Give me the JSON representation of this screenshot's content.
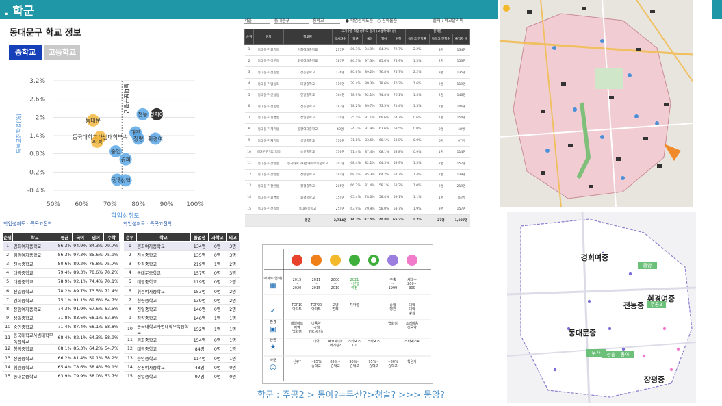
{
  "header": {
    "title": ". 학군"
  },
  "left": {
    "title": "동대문구 학교 정보",
    "tabs": [
      {
        "label": "중학교",
        "active": true
      },
      {
        "label": "고등학교",
        "active": false
      }
    ],
    "notes": [
      "학업성취도 : 특목고진학",
      "학업성취도 : 특목고진학"
    ]
  },
  "chart_data": {
    "type": "scatter",
    "xlabel": "학업성취도",
    "ylabel": "특목고진학률(%)",
    "xticks": [
      "50%",
      "60%",
      "70%",
      "80%",
      "90%",
      "100%"
    ],
    "yticks": [
      "3.2%",
      "2.6%",
      "2%",
      "1.4%",
      "0.8%",
      "0.2%",
      "-0.4%"
    ],
    "xlim": [
      0.5,
      1.0
    ],
    "ylim": [
      -0.4,
      3.2
    ],
    "points": [
      {
        "name": "동대문",
        "x": 0.64,
        "y": 1.9,
        "color": "#f3b93e"
      },
      {
        "name": "동국대학교사범대학부속",
        "x": 0.665,
        "y": 1.35,
        "color": "#f3b93e"
      },
      {
        "name": "휘경",
        "x": 0.655,
        "y": 1.2,
        "color": "#f3b93e"
      },
      {
        "name": "숭인",
        "x": 0.72,
        "y": 0.88,
        "color": "#5ba8e8"
      },
      {
        "name": "경희",
        "x": 0.755,
        "y": 0.62,
        "color": "#5ba8e8"
      },
      {
        "name": "장평",
        "x": 0.725,
        "y": -0.05,
        "color": "#5ba8e8"
      },
      {
        "name": "성일",
        "x": 0.755,
        "y": -0.07,
        "color": "#5ba8e8"
      },
      {
        "name": "전농",
        "x": 0.815,
        "y": 2.1,
        "color": "#5ba8e8"
      },
      {
        "name": "경희여",
        "x": 0.865,
        "y": 2.1,
        "color": "#111111"
      },
      {
        "name": "대광",
        "x": 0.79,
        "y": 1.5,
        "color": "#5ba8e8"
      },
      {
        "name": "청량",
        "x": 0.8,
        "y": 1.3,
        "color": "#5ba8e8"
      },
      {
        "name": "휘경여",
        "x": 0.86,
        "y": 1.3,
        "color": "#5ba8e8"
      }
    ],
    "avg_label": "동대문구평균"
  },
  "table_a": {
    "headers": [
      "순위",
      "학교",
      "평균",
      "국어",
      "영어",
      "수학"
    ],
    "rows": [
      [
        "1",
        "경희여자중학교",
        "86.3%",
        "94.9%",
        "84.3%",
        "79.7%"
      ],
      [
        "2",
        "휘경여자중학교",
        "86.3%",
        "97.3%",
        "85.6%",
        "75.9%"
      ],
      [
        "3",
        "전농중학교",
        "80.6%",
        "89.2%",
        "76.8%",
        "75.7%"
      ],
      [
        "4",
        "대광중학교",
        "79.4%",
        "89.3%",
        "78.6%",
        "70.2%"
      ],
      [
        "5",
        "대광중학교",
        "78.9%",
        "92.1%",
        "74.4%",
        "70.1%"
      ],
      [
        "6",
        "전일중학교",
        "78.2%",
        "89.7%",
        "73.5%",
        "71.4%"
      ],
      [
        "7",
        "경희중학교",
        "75.1%",
        "91.1%",
        "69.6%",
        "64.7%"
      ],
      [
        "8",
        "장평여자중학교",
        "74.3%",
        "91.9%",
        "67.6%",
        "63.5%"
      ],
      [
        "9",
        "성일중학교",
        "71.8%",
        "83.6%",
        "68.1%",
        "63.8%"
      ],
      [
        "10",
        "숭인중학교",
        "71.4%",
        "87.4%",
        "68.1%",
        "58.8%"
      ],
      [
        "11",
        "동국대학교사범대학부속중학교",
        "68.4%",
        "82.1%",
        "64.3%",
        "58.9%"
      ],
      [
        "12",
        "청량중학교",
        "68.1%",
        "85.3%",
        "64.2%",
        "54.7%"
      ],
      [
        "13",
        "장평중학교",
        "66.2%",
        "81.4%",
        "59.1%",
        "58.2%"
      ],
      [
        "14",
        "휘경중학교",
        "65.4%",
        "78.6%",
        "58.4%",
        "59.1%"
      ],
      [
        "15",
        "동대문중학교",
        "63.9%",
        "79.9%",
        "58.0%",
        "53.7%"
      ]
    ]
  },
  "table_b": {
    "headers": [
      "순위",
      "학교",
      "졸업생",
      "과학고",
      "외고"
    ],
    "rows": [
      [
        "1",
        "경희여자중학교",
        "134명",
        "0명",
        "3명"
      ],
      [
        "2",
        "전농중학교",
        "135명",
        "0명",
        "3명"
      ],
      [
        "3",
        "장평중학교",
        "219명",
        "1명",
        "2명"
      ],
      [
        "4",
        "동대문중학교",
        "157명",
        "0명",
        "3명"
      ],
      [
        "5",
        "대광중학교",
        "119명",
        "0명",
        "2명"
      ],
      [
        "6",
        "휘경여자중학교",
        "153명",
        "0명",
        "2명"
      ],
      [
        "7",
        "청량중학교",
        "139명",
        "0명",
        "2명"
      ],
      [
        "8",
        "전일중학교",
        "146명",
        "0명",
        "2명"
      ],
      [
        "9",
        "청량중학교",
        "146명",
        "1명",
        "1명"
      ],
      [
        "10",
        "동국대학교사범대학부속중학교",
        "152명",
        "1명",
        "1명"
      ],
      [
        "11",
        "경희중학교",
        "154명",
        "0명",
        "1명"
      ],
      [
        "12",
        "대광중학교",
        "84명",
        "0명",
        "1명"
      ],
      [
        "13",
        "숭인중학교",
        "114명",
        "0명",
        "1명"
      ],
      [
        "14",
        "장평여자중학교",
        "48명",
        "0명",
        "0명"
      ],
      [
        "15",
        "성일중학교",
        "97명",
        "0명",
        "0명"
      ]
    ]
  },
  "mid": {
    "filters": [
      "서울",
      "동대문구",
      "중학교"
    ],
    "radio": [
      "학업성취도순",
      "진학률순"
    ],
    "source": "출처 : 학교알리미",
    "headers": [
      "순위",
      "위치",
      "학교명",
      "응시자수",
      "평균",
      "국어",
      "영어",
      "수학",
      "특목고 진학률",
      "특목고 진학수",
      "졸업자 수"
    ],
    "group_header": "국가수준 학업성취도 평가 (보통학력이상)",
    "group_header2": "진학률",
    "rows": [
      [
        "1",
        "동대문구 휘경동",
        "경희여자중학교",
        "217명",
        "86.3%",
        "94.9%",
        "84.3%",
        "79.7%",
        "2.2%",
        "3명",
        "134명"
      ],
      [
        "2",
        "동대문구 이문동",
        "휘경여자중학교",
        "187명",
        "86.3%",
        "97.3%",
        "85.6%",
        "75.9%",
        "1.3%",
        "2명",
        "153명"
      ],
      [
        "3",
        "동대문구 전농동",
        "전농중학교",
        "176명",
        "80.6%",
        "89.2%",
        "76.8%",
        "75.7%",
        "2.2%",
        "3명",
        "135명"
      ],
      [
        "4",
        "동대문구 답십리",
        "대광중학교",
        "119명",
        "79.4%",
        "89.3%",
        "78.6%",
        "70.2%",
        "1.6%",
        "2명",
        "119명"
      ],
      [
        "5",
        "동대문구 신설동",
        "전일중학교",
        "164명",
        "78.9%",
        "92.1%",
        "74.4%",
        "70.1%",
        "1.3%",
        "2명",
        "146명"
      ],
      [
        "6",
        "동대문구 전농동",
        "전농중학교",
        "183명",
        "78.2%",
        "89.7%",
        "73.5%",
        "71.4%",
        "1.3%",
        "2명",
        "146명"
      ],
      [
        "7",
        "동대문구 휘경동",
        "성일중학교",
        "214명",
        "75.1%",
        "91.1%",
        "69.6%",
        "64.7%",
        "0.6%",
        "1명",
        "154명"
      ],
      [
        "8",
        "동대문구 제기동",
        "장평여자중학교",
        "48명",
        "74.3%",
        "91.9%",
        "67.6%",
        "63.5%",
        "0.0%",
        "0명",
        "48명"
      ],
      [
        "9",
        "동대문구 제기동",
        "성일중학교",
        "110명",
        "71.8%",
        "83.6%",
        "68.1%",
        "63.8%",
        "0.0%",
        "0명",
        "97명"
      ],
      [
        "10",
        "동대문구 답십리동",
        "숭인중학교",
        "116명",
        "71.4%",
        "87.4%",
        "68.1%",
        "58.8%",
        "0.9%",
        "1명",
        "114명"
      ],
      [
        "11",
        "동대문구 장안동",
        "동국대학교사범대학부속중학교",
        "207명",
        "68.4%",
        "82.1%",
        "64.3%",
        "58.9%",
        "1.3%",
        "2명",
        "152명"
      ],
      [
        "12",
        "동대문구 장안동",
        "청량중학교",
        "191명",
        "68.1%",
        "85.3%",
        "64.2%",
        "54.7%",
        "1.4%",
        "2명",
        "139명"
      ],
      [
        "13",
        "동대문구 장안동",
        "장평중학교",
        "205명",
        "66.2%",
        "81.4%",
        "59.1%",
        "58.2%",
        "1.0%",
        "2명",
        "219명"
      ],
      [
        "14",
        "동대문구 휘경동",
        "휘경중학교",
        "154명",
        "65.4%",
        "78.6%",
        "58.4%",
        "59.1%",
        "1.1%",
        "1명",
        "84명"
      ],
      [
        "15",
        "동대문구 전농동",
        "동대문중학교",
        "254명",
        "63.9%",
        "79.9%",
        "58.0%",
        "53.7%",
        "1.9%",
        "3명",
        "157명"
      ]
    ],
    "total": [
      "",
      "",
      "평균",
      "2,714명",
      "74.2%",
      "87.5%",
      "70.0%",
      "65.2%",
      "1.2%",
      "27명",
      "1,997명"
    ]
  },
  "legend_grid": {
    "colors": [
      "#e8412c",
      "#f07f18",
      "#f3b92b",
      "#3fae3a",
      "#3fae3a",
      "#9b7ee0",
      "#f17ccb"
    ],
    "row_labels": [
      "아파트(연식)",
      "",
      "환경",
      "상권",
      "학군"
    ],
    "row1": [
      "2015\n~\n2020",
      "2011\n~\n2015",
      "2000\n~\n2010",
      "2021\n~진행\n예정",
      "",
      "구축\n~\n1999",
      "세대수\n200~\n300"
    ],
    "row2": [
      "TOP10\n아파트",
      "TOP20\n아파트",
      "모양\n범례",
      "지하철",
      "",
      "종합\n병원",
      "대학\n대학\n병원"
    ],
    "row3": [
      "대형마트\n지역\n백화점",
      "이용약\n~(월\nNC,세이)",
      "",
      "",
      "",
      "백화점",
      "조리비용\n이용약"
    ],
    "row4": [
      "",
      "대학",
      "쎄브웨이?\n머거킹?",
      "스타벅스\nDT",
      "스타벅스",
      "",
      "스타벅스R"
    ],
    "row5": [
      "신규?",
      "~85%\n중학교",
      "85%~\n중학교",
      "90%~\n중학교",
      "95%~\n중학교",
      "~80%\n중학교",
      "학원가"
    ]
  },
  "bottom_note": "학군 : 주공2 > 동아?=두산?>청솔?   >>> 동양?",
  "map2_labels": [
    "경희여중",
    "휘경여중",
    "전농중",
    "동대문중",
    "장평중",
    "동양",
    "주공2",
    "두산",
    "동아",
    "청솔"
  ]
}
